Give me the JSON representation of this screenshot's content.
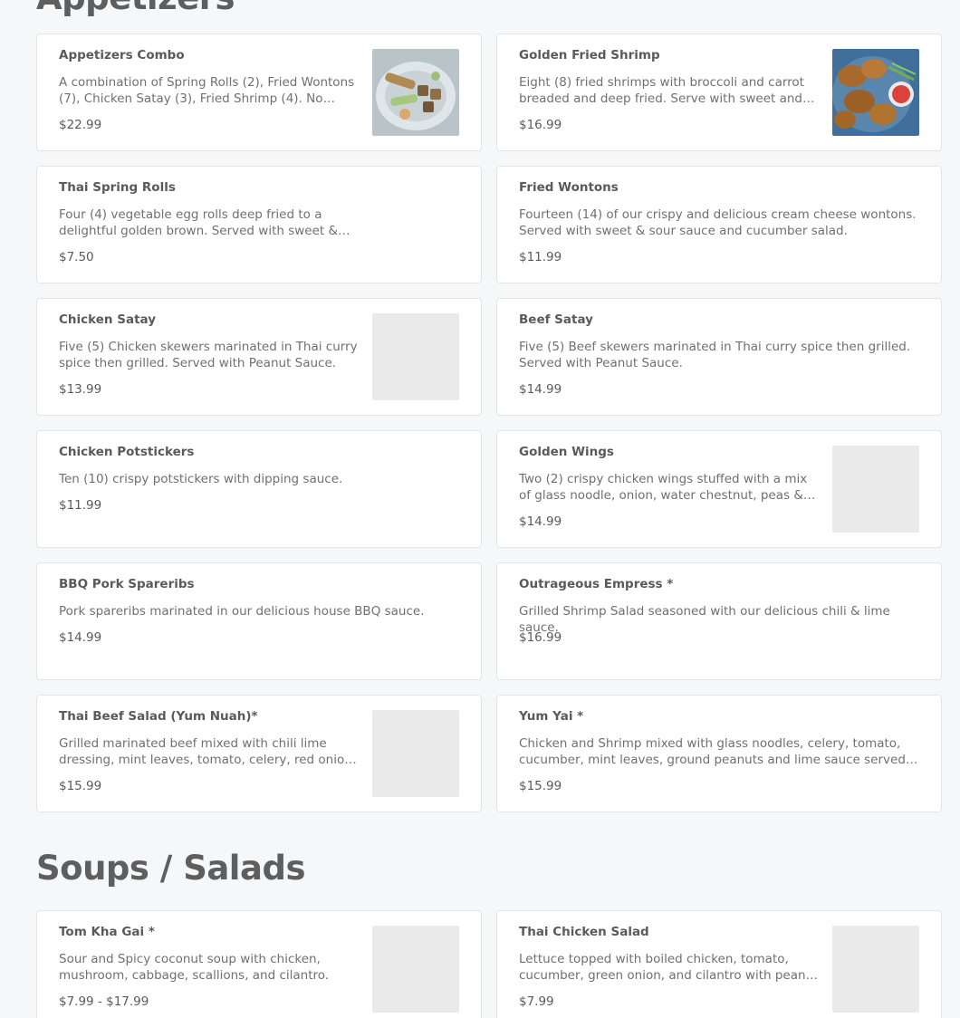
{
  "sections": {
    "appetizers": {
      "title": "Appetizers",
      "items": [
        {
          "name": "Appetizers Combo",
          "desc": "A combination of Spring Rolls (2), Fried Wontons (7), Chicken Satay (3), Fried Shrimp (4). No substitutions.",
          "price": "$22.99",
          "image": "appetizers-combo-photo"
        },
        {
          "name": "Golden Fried Shrimp",
          "desc": "Eight (8) fried shrimps with broccoli and carrot breaded and deep fried. Serve with sweet and sour sauce.",
          "price": "$16.99",
          "image": "golden-fried-shrimp-photo"
        },
        {
          "name": "Thai Spring Rolls",
          "desc": "Four (4) vegetable egg rolls deep fried to a delightful golden brown. Served with sweet & sour sauce.",
          "price": "$7.50"
        },
        {
          "name": "Fried Wontons",
          "desc": "Fourteen (14) of our crispy and delicious cream cheese wontons. Served with sweet & sour sauce and cucumber salad.",
          "price": "$11.99"
        },
        {
          "name": "Chicken Satay",
          "desc": "Five (5) Chicken skewers marinated in Thai curry spice then grilled. Served with Peanut Sauce.",
          "price": "$13.99",
          "image": "placeholder"
        },
        {
          "name": "Beef Satay",
          "desc": "Five (5) Beef skewers marinated in Thai curry spice then grilled. Served with Peanut Sauce.",
          "price": "$14.99"
        },
        {
          "name": "Chicken Potstickers",
          "desc": "Ten (10) crispy potstickers with dipping sauce.",
          "price": "$11.99"
        },
        {
          "name": "Golden Wings",
          "desc": "Two (2) crispy chicken wings stuffed with a mix of glass noodle, onion, water chestnut, peas & carrots.",
          "price": "$14.99",
          "image": "placeholder"
        },
        {
          "name": "BBQ Pork Spareribs",
          "desc": "Pork spareribs marinated in our delicious house BBQ sauce.",
          "price": "$14.99"
        },
        {
          "name": "Outrageous Empress *",
          "desc": "Grilled Shrimp Salad seasoned with our delicious chili & lime sauce.",
          "price": "$16.99"
        },
        {
          "name": "Thai Beef Salad (Yum Nuah)*",
          "desc": "Grilled marinated beef mixed with chili lime dressing, mint leaves, tomato, celery, red onion and cucumber.",
          "price": "$15.99",
          "image": "placeholder"
        },
        {
          "name": "Yum Yai *",
          "desc": "Chicken and Shrimp mixed with glass noodles, celery, tomato, cucumber, mint leaves, ground peanuts and lime sauce served on lettuce.",
          "price": "$15.99"
        }
      ]
    },
    "soups": {
      "title": "Soups / Salads",
      "items": [
        {
          "name": "Tom Kha Gai *",
          "desc": "Sour and Spicy coconut soup with chicken, mushroom, cabbage, scallions, and cilantro.",
          "price": "$7.99 - $17.99",
          "image": "placeholder"
        },
        {
          "name": "Thai Chicken Salad",
          "desc": "Lettuce topped with boiled chicken, tomato, cucumber, green onion, and cilantro with peanut dressing.",
          "price": "$7.99",
          "image": "placeholder"
        }
      ]
    }
  }
}
